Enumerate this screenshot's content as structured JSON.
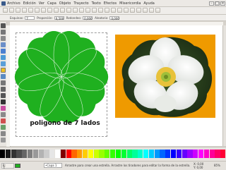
{
  "menu": {
    "items": [
      "Archivo",
      "Edición",
      "Ver",
      "Capa",
      "Objeto",
      "Trayecto",
      "Texto",
      "Efectos",
      "Misericordia",
      "Ayuda"
    ]
  },
  "tool_controls": {
    "labels": [
      "Esquinas:",
      "Proporción:",
      "Redondeo:",
      "Aleatorio:"
    ],
    "values": [
      "7",
      "0,500",
      "0,000",
      "0,000"
    ]
  },
  "canvas": {
    "caption": "poligono de 7 lados",
    "star_color": "#1fb01f",
    "photo_bg_color": "#ef9a00"
  },
  "palette": {
    "colors": [
      "#000000",
      "#1a1a1a",
      "#333333",
      "#4d4d4d",
      "#666666",
      "#808080",
      "#999999",
      "#b3b3b3",
      "#cccccc",
      "#e6e6e6",
      "#ffffff",
      "#800000",
      "#ff0000",
      "#ff6600",
      "#ff9900",
      "#ffcc00",
      "#ffff00",
      "#ccff00",
      "#99ff00",
      "#66ff00",
      "#33ff00",
      "#00ff00",
      "#00ff33",
      "#00ff66",
      "#00ff99",
      "#00ffcc",
      "#00ffff",
      "#00ccff",
      "#0099ff",
      "#0066ff",
      "#0033ff",
      "#0000ff",
      "#3300ff",
      "#6600ff",
      "#9900ff",
      "#cc00ff",
      "#ff00ff",
      "#ff00cc",
      "#ff0099",
      "#ff0066",
      "#ff0033"
    ]
  },
  "status": {
    "fill_label": "R:",
    "stroke_label": "T:",
    "layer": "•Capa 1",
    "message": "Arrastre para crear una estrella. Arrastre los tiradores para editar la forma de la estrella.",
    "coords_x": "X: 0,00",
    "coords_y": "Y: 0,00",
    "zoom": "85%"
  }
}
